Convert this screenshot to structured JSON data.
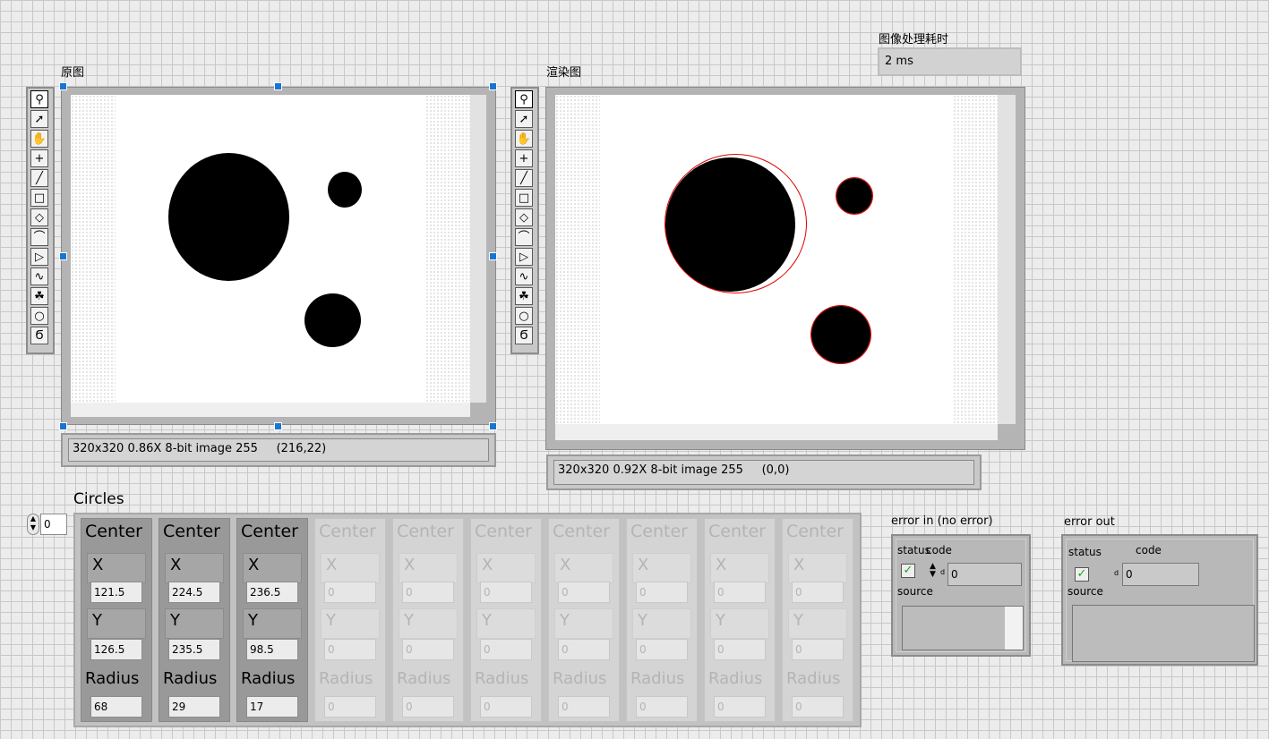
{
  "original": {
    "label": "原图",
    "info": "320x320 0.86X 8-bit image 255     (216,22)"
  },
  "rendered": {
    "label": "渲染图",
    "info": "320x320 0.92X 8-bit image 255     (0,0)"
  },
  "timing": {
    "label": "图像处理耗时",
    "value": "2 ms"
  },
  "tools": [
    "zoom-icon",
    "arrow-icon",
    "pan-hand-icon",
    "crosshair-icon",
    "line-icon",
    "rectangle-icon",
    "rotated-rect-icon",
    "annulus-icon",
    "polygon-icon",
    "freehand-icon",
    "freehand-region-icon",
    "oval-icon",
    "broken-annulus-icon"
  ],
  "circles": {
    "label": "Circles",
    "index": "0",
    "center_label": "Center",
    "x_label": "X",
    "y_label": "Y",
    "radius_label": "Radius",
    "items": [
      {
        "x": "121.5",
        "y": "126.5",
        "r": "68"
      },
      {
        "x": "224.5",
        "y": "235.5",
        "r": "29"
      },
      {
        "x": "236.5",
        "y": "98.5",
        "r": "17"
      },
      {
        "x": "0",
        "y": "0",
        "r": "0"
      },
      {
        "x": "0",
        "y": "0",
        "r": "0"
      },
      {
        "x": "0",
        "y": "0",
        "r": "0"
      },
      {
        "x": "0",
        "y": "0",
        "r": "0"
      },
      {
        "x": "0",
        "y": "0",
        "r": "0"
      },
      {
        "x": "0",
        "y": "0",
        "r": "0"
      },
      {
        "x": "0",
        "y": "0",
        "r": "0"
      }
    ]
  },
  "error_in": {
    "label": "error in (no error)",
    "status_label": "status",
    "code_label": "code",
    "code_value": "0",
    "code_type": "d",
    "source_label": "source",
    "status_mark": "✓"
  },
  "error_out": {
    "label": "error out",
    "status_label": "status",
    "code_label": "code",
    "code_value": "0",
    "code_type": "d",
    "source_label": "source",
    "status_mark": "✓"
  }
}
